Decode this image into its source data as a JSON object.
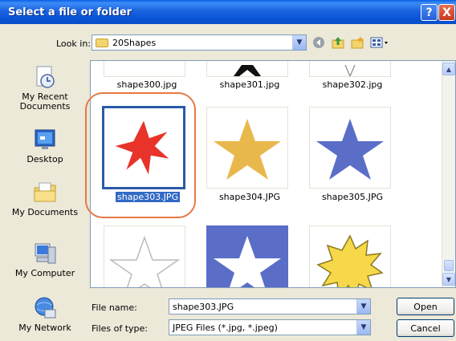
{
  "window": {
    "title": "Select a file or folder",
    "help_label": "?",
    "close_label": "X"
  },
  "lookin": {
    "label": "Look in:",
    "value": "20Shapes"
  },
  "toolbar": {
    "icons": [
      "back-icon",
      "up-folder-icon",
      "new-folder-icon",
      "views-menu-icon"
    ]
  },
  "places": {
    "recent": "My Recent Documents",
    "desktop": "Desktop",
    "documents": "My Documents",
    "computer": "My Computer",
    "network": "My Network"
  },
  "files": [
    {
      "name": "shape300.jpg"
    },
    {
      "name": "shape301.jpg"
    },
    {
      "name": "shape302.jpg"
    },
    {
      "name": "shape303.JPG",
      "selected": true
    },
    {
      "name": "shape304.JPG"
    },
    {
      "name": "shape305.JPG"
    }
  ],
  "colors": {
    "selection": "#316ac5",
    "highlight_ring": "#e67845",
    "red_star": "#e8332a",
    "gold_star": "#e9b84c",
    "blue_star": "#5a6ec8"
  },
  "form": {
    "filename_label": "File name:",
    "filename_value": "shape303.JPG",
    "filetype_label": "Files of type:",
    "filetype_value": "JPEG Files (*.jpg, *.jpeg)",
    "open_label": "Open",
    "cancel_label": "Cancel"
  }
}
